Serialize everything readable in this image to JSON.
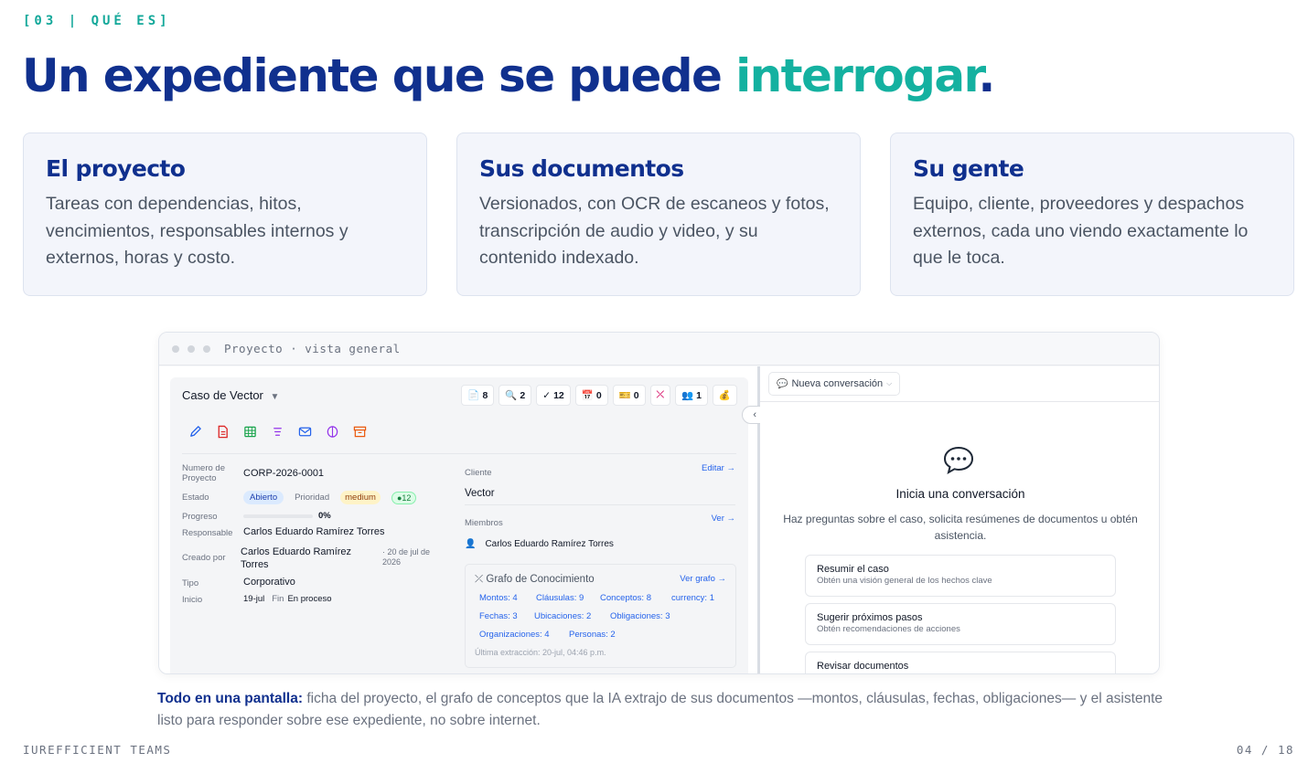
{
  "slide": {
    "kicker": "[03 | QUÉ ES]",
    "headline_main": "Un expediente que se puede ",
    "headline_accent": "interrogar",
    "headline_end": ".",
    "caption_bold": "Todo en una pantalla:",
    "caption_rest": " ficha del proyecto, el grafo de conceptos que la IA extrajo de sus documentos —montos, cláusulas, fechas, obligaciones— y el asistente listo para responder sobre ese expediente, no sobre internet.",
    "footer_brand": "IUREFFICIENT TEAMS",
    "page_counter": "04 / 18"
  },
  "cards": [
    {
      "title": "El proyecto",
      "body": "Tareas con dependencias, hitos, vencimientos, responsables internos y externos, horas y costo."
    },
    {
      "title": "Sus documentos",
      "body": "Versionados, con OCR de escaneos y fotos, transcripción de audio y video, y su contenido indexado."
    },
    {
      "title": "Su gente",
      "body": "Equipo, cliente, proveedores y despachos externos, cada uno viendo exactamente lo que le toca."
    }
  ],
  "window": {
    "title": "Proyecto · vista general"
  },
  "project": {
    "name": "Caso de Vector",
    "caret": "▼",
    "chips": [
      {
        "icon": "📄",
        "count": "8",
        "name": "documents-chip"
      },
      {
        "icon": "🔍",
        "count": "2",
        "name": "search-chip"
      },
      {
        "icon": "✓",
        "count": "12",
        "name": "tasks-chip"
      },
      {
        "icon": "📅",
        "count": "0",
        "name": "calendar-chip"
      },
      {
        "icon": "🎫",
        "count": "0",
        "name": "tickets-chip"
      },
      {
        "icon": "⤫",
        "count": "",
        "name": "graph-chip"
      },
      {
        "icon": "👥",
        "count": "1",
        "name": "members-chip"
      },
      {
        "icon": "💰",
        "count": "",
        "name": "billing-chip"
      }
    ],
    "labels": {
      "number": "Numero de Proyecto",
      "status": "Estado",
      "priority": "Prioridad",
      "progress": "Progreso",
      "owner": "Responsable",
      "created_by": "Creado por",
      "type": "Tipo",
      "start": "Inicio",
      "end": "Fin"
    },
    "number": "CORP-2026-0001",
    "status": "Abierto",
    "priority": "medium",
    "task_count": "12",
    "progress_text": "0%",
    "progress_fraction": 0,
    "owner": "Carlos Eduardo Ramírez Torres",
    "created_by": "Carlos Eduardo Ramírez Torres",
    "created_on": "· 20 de jul de 2026",
    "type": "Corporativo",
    "start": "19-jul",
    "end": "En proceso",
    "client_label": "Cliente",
    "edit_link": "Editar →",
    "client": "Vector",
    "members_label": "Miembros",
    "view_link": "Ver →",
    "member": "Carlos Eduardo Ramírez Torres"
  },
  "knowledge_graph": {
    "title": "Grafo de Conocimiento",
    "link": "Ver grafo →",
    "tags": [
      "Montos: 4",
      "Cláusulas: 9",
      "Conceptos: 8",
      "currency: 1",
      "Fechas: 3",
      "Ubicaciones: 2",
      "Obligaciones: 3",
      "Organizaciones: 4",
      "Personas: 2"
    ],
    "footer": "Última extracción: 20-jul, 04:46 p.m."
  },
  "assistant": {
    "new_conversation": "Nueva conversación",
    "empty_title": "Inicia una conversación",
    "empty_subtitle": "Haz preguntas sobre el caso, solicita resúmenes de documentos u obtén asistencia.",
    "suggestions": [
      {
        "title": "Resumir el caso",
        "subtitle": "Obtén una visión general de los hechos clave"
      },
      {
        "title": "Sugerir próximos pasos",
        "subtitle": "Obtén recomendaciones de acciones"
      },
      {
        "title": "Revisar documentos",
        "subtitle": ""
      }
    ]
  },
  "colors": {
    "navy": "#10308e",
    "teal": "#14b1a0",
    "link": "#2563eb"
  }
}
